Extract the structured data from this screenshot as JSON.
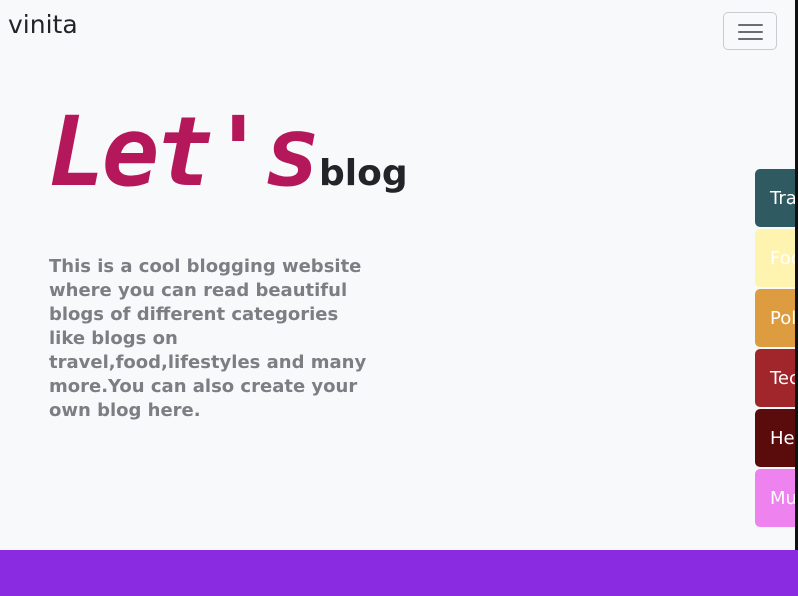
{
  "navbar": {
    "brand": "vinita",
    "toggler_icon": "hamburger-menu-icon"
  },
  "hero": {
    "title_big": "Let's",
    "title_small": "blog",
    "description": "This is a cool blogging website where you can read beautiful blogs of different categories like blogs on travel,food,lifestyles and many more.You can also create your own blog here."
  },
  "categories": [
    {
      "label": "Tra",
      "color": "#2f5a61"
    },
    {
      "label": "Foo",
      "color": "#fff3b0"
    },
    {
      "label": "Pol",
      "color": "#dd9c3f"
    },
    {
      "label": "Tec",
      "color": "#a0262c"
    },
    {
      "label": "He",
      "color": "#5a0c0d"
    },
    {
      "label": "Mu",
      "color": "#ee82ee"
    }
  ],
  "colors": {
    "title_accent": "#b5175b",
    "footer": "#8a2be2",
    "background": "#f8f9fa"
  }
}
